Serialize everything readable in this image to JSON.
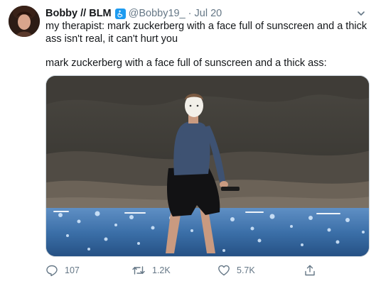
{
  "user": {
    "display_name": "Bobby // BLM",
    "badge_icon": "accessibility-icon",
    "handle": "@Bobby19_",
    "separator": "·",
    "date": "Jul 20"
  },
  "tweet": {
    "line1": "my therapist: mark zuckerberg with a face full of sunscreen and a thick ass isn't real, it can't hurt you",
    "line2": "mark zuckerberg with a face full of sunscreen and a thick ass:"
  },
  "actions": {
    "reply_count": "107",
    "retweet_count": "1.2K",
    "like_count": "5.7K"
  },
  "colors": {
    "accent": "#1d9bf0",
    "muted": "#657786",
    "text": "#14171a"
  }
}
